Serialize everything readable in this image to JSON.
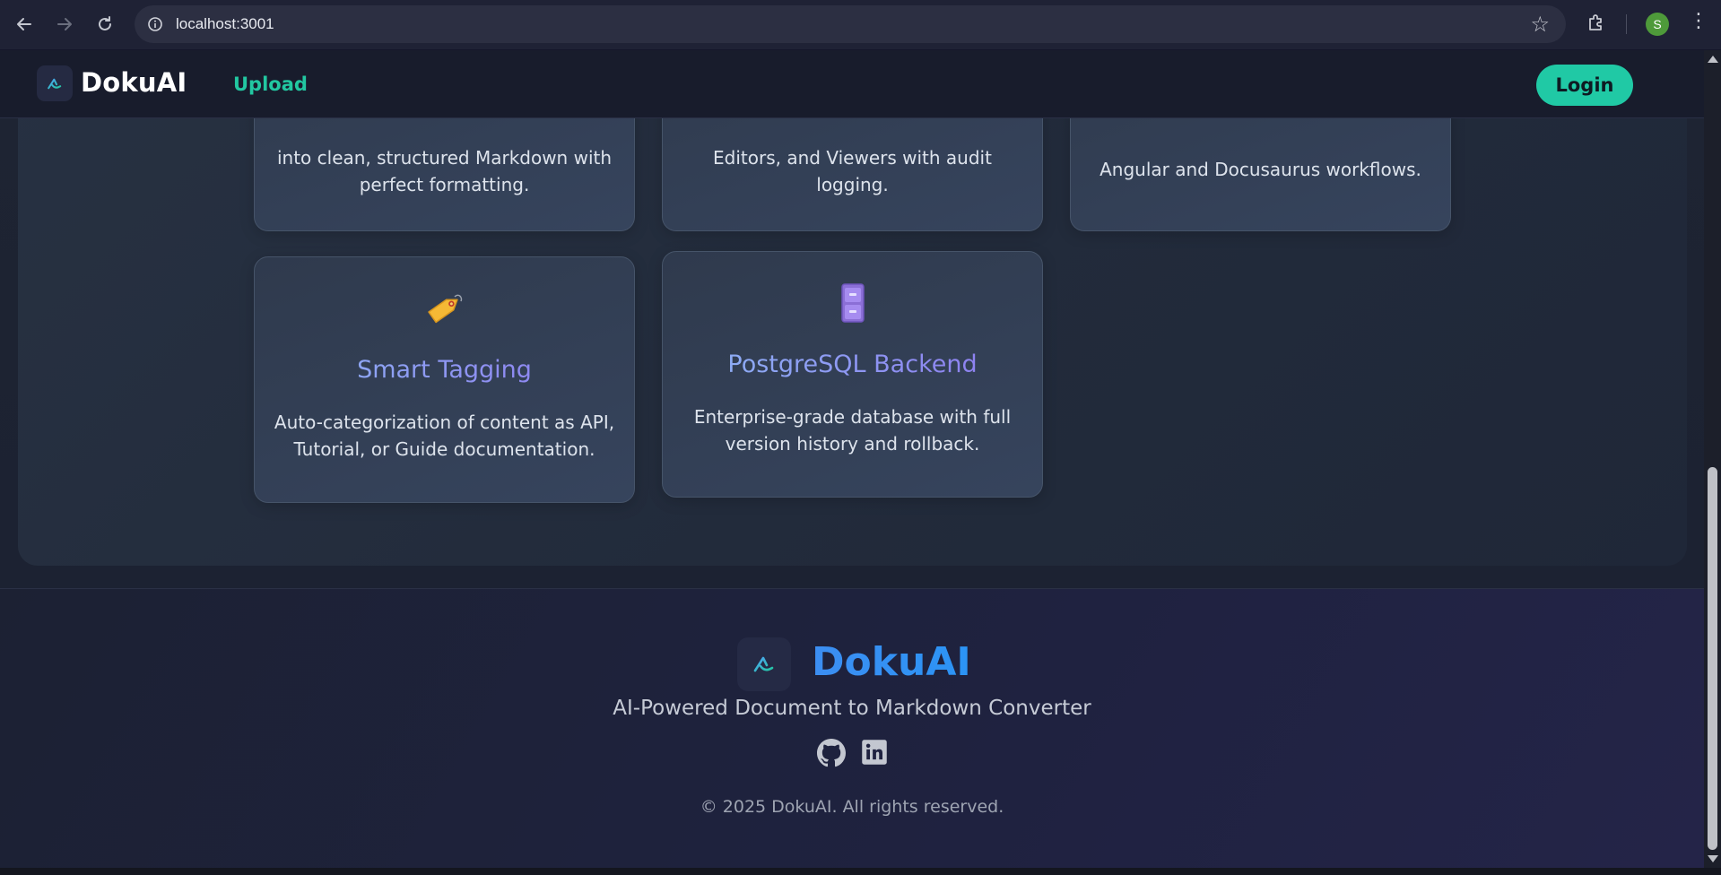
{
  "browser": {
    "url": "localhost:3001",
    "profile_initial": "S",
    "icons": [
      "back-icon",
      "forward-icon",
      "reload-icon",
      "site-info-icon",
      "bookmark-star-icon",
      "extensions-icon",
      "menu-icon"
    ]
  },
  "header": {
    "brand": "DokuAI",
    "nav_upload": "Upload",
    "login_label": "Login"
  },
  "features": {
    "partial_cards": [
      {
        "line1": "into clean, structured Markdown with",
        "line2": "perfect formatting."
      },
      {
        "line1": "Editors, and Viewers with audit",
        "line2": "logging."
      },
      {
        "line1": "Angular and Docusaurus workflows.",
        "line2": ""
      }
    ],
    "cards": [
      {
        "icon": "tag-icon",
        "title": "Smart Tagging",
        "desc": "Auto-categorization of content as API, Tutorial, or Guide documentation."
      },
      {
        "icon": "file-cabinet-icon",
        "title": "PostgreSQL Backend",
        "desc": "Enterprise-grade database with full version history and rollback."
      }
    ]
  },
  "footer": {
    "brand": "DokuAI",
    "tagline": "AI-Powered Document to Markdown Converter",
    "copyright": "© 2025 DokuAI. All rights reserved.",
    "social": [
      "github-icon",
      "linkedin-icon"
    ]
  },
  "colors": {
    "accent": "#20c9a5",
    "brand_blue": "#2b94f5",
    "title_gradient_start": "#8db6f5",
    "title_gradient_end": "#8f78f0",
    "background": "#1e2433"
  }
}
